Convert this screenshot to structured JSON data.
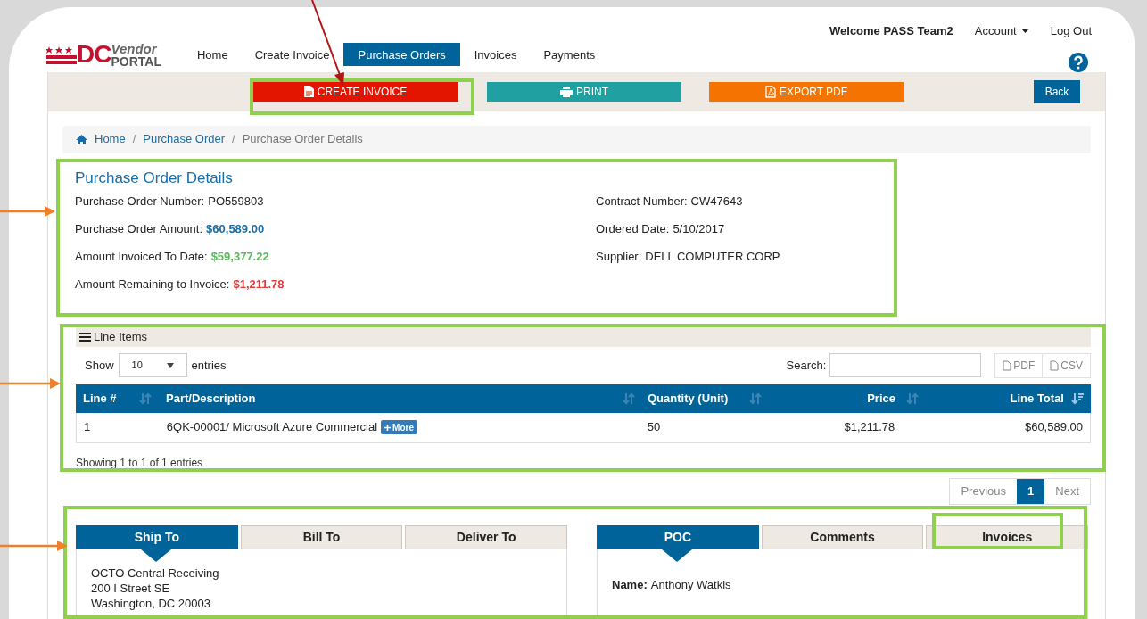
{
  "header": {
    "logo": {
      "main": "DC",
      "top": "Vendor",
      "bottom": "PORTAL"
    },
    "nav": [
      {
        "label": "Home",
        "selected": false
      },
      {
        "label": "Create Invoice",
        "selected": false
      },
      {
        "label": "Purchase Orders",
        "selected": true
      },
      {
        "label": "Invoices",
        "selected": false
      },
      {
        "label": "Payments",
        "selected": false
      }
    ],
    "welcome": "Welcome PASS Team2",
    "account": "Account",
    "logout": "Log Out"
  },
  "actions": [
    {
      "kind": "create",
      "label": "CREATE INVOICE"
    },
    {
      "kind": "print",
      "label": "PRINT"
    },
    {
      "kind": "export",
      "label": "EXPORT PDF"
    },
    {
      "kind": "back",
      "label": "Back"
    }
  ],
  "breadcrumb": [
    "Home",
    "Purchase Order",
    "Purchase Order Details"
  ],
  "breadcrumb_separator": "/",
  "details": {
    "title": "Purchase Order Details",
    "left": [
      {
        "label": "Purchase Order Number:",
        "value": "PO559803"
      },
      {
        "label": "Purchase Order Amount:",
        "value": "$60,589.00",
        "color": "#1a6ca6"
      },
      {
        "label": "Amount Invoiced To Date:",
        "value": "$59,377.22",
        "color": "#5cb85c"
      },
      {
        "label": "Amount Remaining to Invoice:",
        "value": "$1,211.78",
        "color": "#e03c3c"
      }
    ],
    "right": [
      {
        "label": "Contract Number:",
        "value": "CW47643"
      },
      {
        "label": "Ordered Date:",
        "value": "5/10/2017"
      },
      {
        "label": "Supplier:",
        "value": "DELL COMPUTER CORP"
      }
    ]
  },
  "line_items": {
    "title": "Line Items",
    "show_label": "Show",
    "entries_value": "10",
    "entries_label": "entries",
    "search_label": "Search:",
    "exports": [
      "PDF",
      "CSV"
    ],
    "columns": [
      {
        "label": "Line #",
        "sorted": false
      },
      {
        "label": "Part/Description",
        "sorted": false
      },
      {
        "label": "Quantity (Unit)",
        "sorted": false
      },
      {
        "label": "Price",
        "sorted": false
      },
      {
        "label": "Line Total",
        "sorted": true
      }
    ],
    "rows": [
      {
        "cells": [
          "1",
          "6QK-00001/ Microsoft Azure Commercial",
          "50",
          "$1,211.78",
          "$60,589.00"
        ],
        "more": "More"
      }
    ],
    "info": "Showing 1 to 1 of 1 entries"
  },
  "pagination": [
    {
      "label": "Previous",
      "selected": false
    },
    {
      "label": "1",
      "selected": true
    },
    {
      "label": "Next",
      "selected": false
    }
  ],
  "address_tabs": {
    "tabs": [
      {
        "label": "Ship To",
        "selected": true
      },
      {
        "label": "Bill To",
        "selected": false
      },
      {
        "label": "Deliver To",
        "selected": false
      }
    ],
    "lines": [
      "OCTO Central Receiving",
      "200 I Street SE",
      "Washington, DC 20003"
    ]
  },
  "contact_tabs": {
    "tabs": [
      {
        "label": "POC",
        "selected": true
      },
      {
        "label": "Comments",
        "selected": false
      },
      {
        "label": "Invoices",
        "selected": false
      }
    ],
    "name_label": "Name:",
    "name_value": "Anthony Watkis"
  }
}
